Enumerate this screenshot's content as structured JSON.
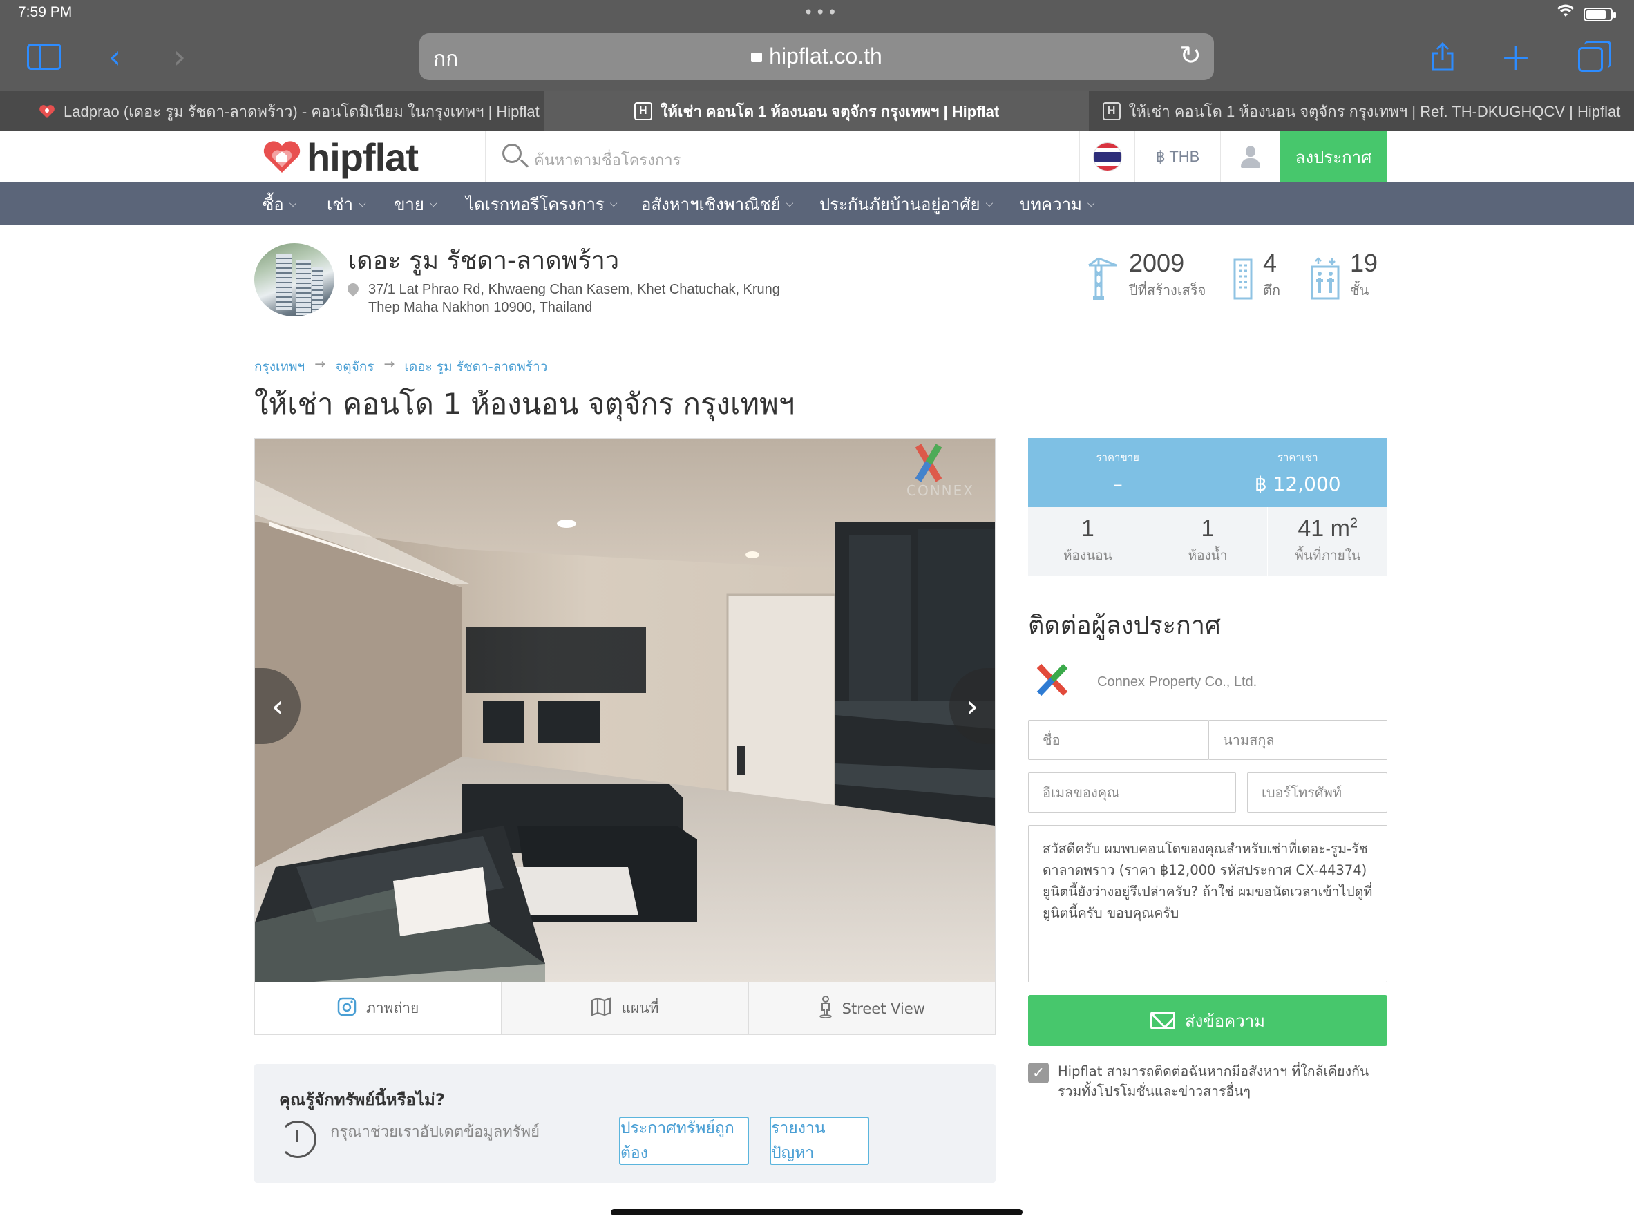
{
  "status_bar": {
    "time": "7:59 PM"
  },
  "browser": {
    "address_prefix": "กก",
    "url": "hipflat.co.th",
    "tabs": [
      {
        "label": "Ladprao (เดอะ รูม รัชดา-ลาดพร้าว) - คอนโดมิเนียม ในกรุงเทพฯ | Hipflat",
        "active": false
      },
      {
        "label": "ให้เช่า คอนโด 1 ห้องนอน จตุจักร กรุงเทพฯ | Hipflat",
        "active": true
      },
      {
        "label": "ให้เช่า คอนโด 1 ห้องนอน จตุจักร กรุงเทพฯ | Ref. TH-DKUGHQCV | Hipflat",
        "active": false
      }
    ],
    "accent_color": "#2d8cff"
  },
  "site": {
    "logo_text": "hipflat",
    "search_placeholder": "ค้นหาตามชื่อโครงการ",
    "currency": "฿ THB",
    "post_button": "ลงประกาศ",
    "brand_color": "#47c76c",
    "nav": [
      "ซื้อ",
      "เช่า",
      "ขาย",
      "ไดเรกทอรีโครงการ",
      "อสังหาฯเชิงพาณิชย์",
      "ประกันภัยบ้านอยู่อาศัย",
      "บทความ"
    ]
  },
  "project": {
    "name": "เดอะ รูม รัชดา-ลาดพร้าว",
    "address_line1": "37/1 Lat Phrao Rd, Khwaeng Chan Kasem, Khet Chatuchak, Krung",
    "address_line2": "Thep Maha Nakhon 10900, Thailand",
    "stats": [
      {
        "value": "2009",
        "label": "ปีที่สร้างเสร็จ",
        "icon": "crane-icon"
      },
      {
        "value": "4",
        "label": "ตึก",
        "icon": "building-icon"
      },
      {
        "value": "19",
        "label": "ชั้น",
        "icon": "elevator-icon"
      }
    ]
  },
  "breadcrumb": [
    "กรุงเทพฯ",
    "จตุจักร",
    "เดอะ รูม รัชดา-ลาดพร้าว"
  ],
  "listing": {
    "title": "ให้เช่า คอนโด 1 ห้องนอน จตุจักร กรุงเทพฯ",
    "media_tabs": [
      "ภาพถ่าย",
      "แผนที่",
      "Street View"
    ],
    "sale_price_label": "ราคาขาย",
    "sale_price": "–",
    "rent_price_label": "ราคาเช่า",
    "rent_price": "฿ 12,000",
    "bedrooms": "1",
    "bedrooms_label": "ห้องนอน",
    "bathrooms": "1",
    "bathrooms_label": "ห้องน้ำ",
    "area_value": "41 m",
    "area_sup": "2",
    "area_label": "พื้นที่ภายใน",
    "price_color": "#7ec0e4"
  },
  "contact": {
    "title": "ติดต่อผู้ลงประกาศ",
    "agent_name": "Connex Property Co., Ltd.",
    "first_name_placeholder": "ชื่อ",
    "last_name_placeholder": "นามสกุล",
    "email_placeholder": "อีเมลของคุณ",
    "phone_placeholder": "เบอร์โทรศัพท์",
    "message": "สวัสดีครับ ผมพบคอนโดของคุณสำหรับเช่าที่เดอะ-รูม-รัชดาลาดพราว (ราคา ฿12,000 รหัสประกาศ CX-44374) ยูนิตนี้ยังว่างอยู่รึเปล่าครับ? ถ้าใช่ ผมขอนัดเวลาเข้าไปดูที่ยูนิตนี้ครับ ขอบคุณครับ",
    "send_button": "ส่งข้อความ",
    "consent_line1": "Hipflat สามารถติดต่อฉันหากมีอสังหาฯ ที่ใกล้เคียงกัน",
    "consent_line2": "รวมทั้งโปรโมชั่นและข่าวสารอื่นๆ",
    "consent_checked": true
  },
  "know_box": {
    "title": "คุณรู้จักทรัพย์นี้หรือไม่?",
    "subtitle": "กรุณาช่วยเราอัปเดตข้อมูลทรัพย์",
    "correct_button": "ประกาศทรัพย์ถูกต้อง",
    "report_button": "รายงานปัญหา"
  }
}
